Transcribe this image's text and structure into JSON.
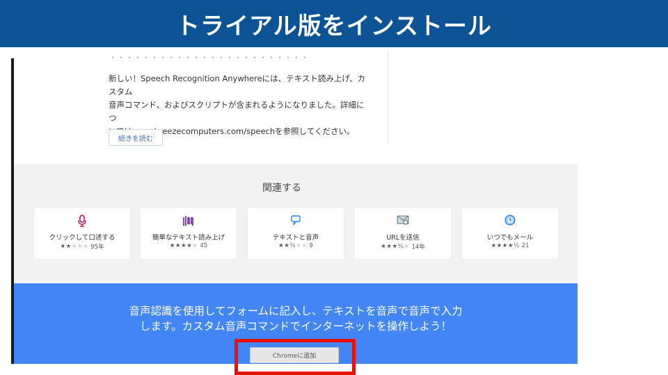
{
  "slide": {
    "title": "トライアル版をインストール"
  },
  "listing": {
    "cut_line": "・・・・・・・・・・・・・・・・・・・・・・・・",
    "description_lines": [
      "新しい！Speech Recognition Anywhereには、テキスト読み上げ、カスタム",
      "音声コマンド、およびスクリプトが含まれるようになりました。詳細につ",
      "いては、seabreezecomputers.com/speechを参照してください。"
    ],
    "read_more_label": "続きを読む"
  },
  "related": {
    "heading": "関連する",
    "items": [
      {
        "name": "クリックして口述する",
        "rating": 2,
        "count": "95年",
        "icon": "microphone-icon",
        "color": "#c2185b"
      },
      {
        "name": "簡単なテキスト読み上げ",
        "rating": 4,
        "count": "45",
        "icon": "waveform-icon",
        "color": "#6a1b9a"
      },
      {
        "name": "テキストと音声",
        "rating": 2.5,
        "count": "9",
        "icon": "speech-bubble-icon",
        "color": "#1e88e5"
      },
      {
        "name": "URLを送信",
        "rating": 3.5,
        "count": "14年",
        "icon": "mail-link-icon",
        "color": "#607d8b"
      },
      {
        "name": "いつでもメール",
        "rating": 4.5,
        "count": "21",
        "icon": "clock-mail-icon",
        "color": "#1565c0"
      }
    ]
  },
  "cta": {
    "lines": [
      "音声認識を使用してフォームに記入し、テキストを音声で音声で入力",
      "します。カスタム音声コマンドでインターネットを操作しよう！"
    ],
    "add_button_label": "Chromeに追加"
  }
}
